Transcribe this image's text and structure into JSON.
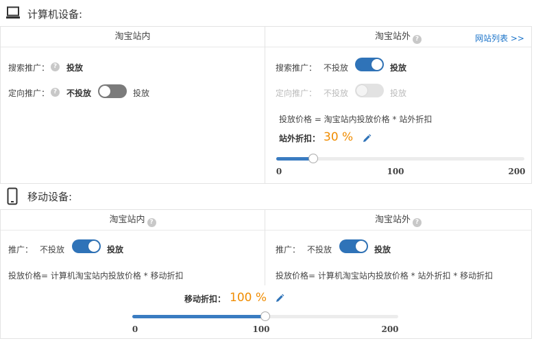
{
  "computer": {
    "title": "计算机设备:",
    "icon": "laptop-icon",
    "inside": {
      "header": "淘宝站内",
      "search_label": "搜索推广：",
      "search_value": "投放",
      "target_label": "定向推广：",
      "target_off": "不投放",
      "target_on": "投放",
      "target_toggle": false
    },
    "outside": {
      "header": "淘宝站外",
      "site_list_link": "网站列表 >>",
      "search_label": "搜索推广：",
      "search_off": "不投放",
      "search_on": "投放",
      "search_toggle": true,
      "target_label": "定向推广：",
      "target_off": "不投放",
      "target_on": "投放",
      "target_toggle_disabled": true,
      "formula": "投放价格 = 淘宝站内投放价格 * 站外折扣",
      "discount_label": "站外折扣：",
      "discount_value": "30 %",
      "slider": {
        "min": 0,
        "max": 200,
        "value": 30,
        "ticks": [
          "0",
          "100",
          "200"
        ]
      }
    }
  },
  "mobile": {
    "title": "移动设备:",
    "icon": "mobile-phone-icon",
    "inside": {
      "header": "淘宝站内",
      "promo_label": "推广：",
      "promo_off": "不投放",
      "promo_on": "投放",
      "promo_toggle": true,
      "formula": "投放价格= 计算机淘宝站内投放价格 * 移动折扣"
    },
    "outside": {
      "header": "淘宝站外",
      "promo_label": "推广：",
      "promo_off": "不投放",
      "promo_on": "投放",
      "promo_toggle": true,
      "formula": "投放价格= 计算机淘宝站内投放价格 * 站外折扣 * 移动折扣"
    },
    "discount_label": "移动折扣：",
    "discount_value": "100 %",
    "slider": {
      "min": 0,
      "max": 200,
      "value": 100,
      "ticks": [
        "0",
        "100",
        "200"
      ]
    }
  },
  "colors": {
    "accent": "#2f73b8",
    "orange": "#f08c00",
    "link": "#1a73c9"
  }
}
